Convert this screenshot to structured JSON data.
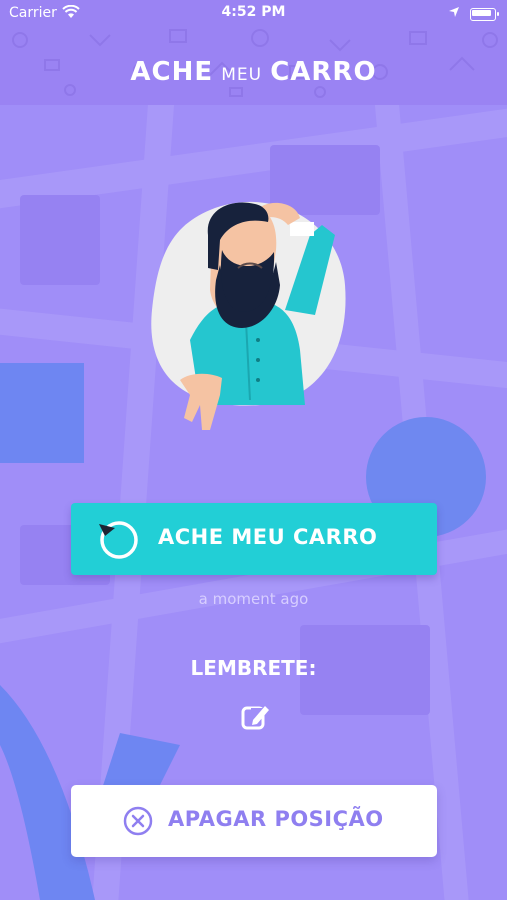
{
  "status_bar": {
    "carrier": "Carrier",
    "time": "4:52 PM"
  },
  "header": {
    "logo_left": "ACHE",
    "logo_middle": "MEU",
    "logo_right": "CARRO"
  },
  "illustration": {
    "icon": "confused-man-illustration"
  },
  "find_button": {
    "label": "ACHE MEU CARRO",
    "icon": "refresh-icon"
  },
  "last_update": "a moment ago",
  "reminder": {
    "label": "LEMBRETE:",
    "icon": "edit-icon"
  },
  "clear_button": {
    "label": "APAGAR POSIÇÃO",
    "icon": "close-circle-icon"
  },
  "colors": {
    "background": "#a08ef8",
    "header": "#9a83f3",
    "accent": "#22cfd6",
    "clear_text": "#8f7ff0"
  }
}
